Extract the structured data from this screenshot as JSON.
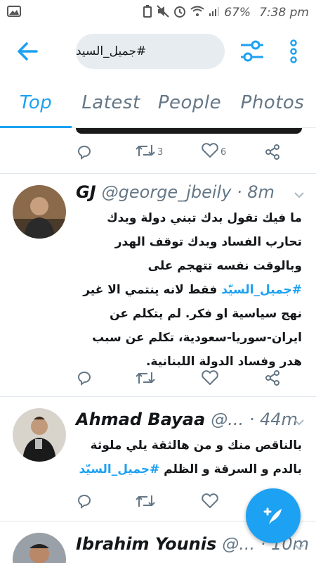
{
  "status_bar": {
    "battery": "67%",
    "time": "7:38 pm"
  },
  "search": {
    "query": "#جميل_السيد"
  },
  "tabs": [
    {
      "label": "Top"
    },
    {
      "label": "Latest"
    },
    {
      "label": "People"
    },
    {
      "label": "Photos"
    }
  ],
  "tweets": [
    {
      "retweets": "3",
      "likes": "6"
    },
    {
      "name": "GJ",
      "handle": "@george_jbeily · 8m",
      "text_before": "ما فيك تقول بدك تبني دولة وبدك تحارب الفساد وبدك توقف الهدر وبالوقت نفسه تتهجم على ",
      "hashtag": "#جميل_السيّد",
      "text_after": " فقط لانه ينتمي الا غير نهج سياسية او فكر. لم يتكلم عن ايران-سوريا-سعودية، تكلم عن سبب هدر وفساد الدولة اللبنانية."
    },
    {
      "name": "Ahmad Bayaa",
      "handle": "@... · 44m",
      "text_before": "بالناقص منك و من هالثقة يلي ملوثة بالدم و السرقة و الظلم ",
      "hashtag": "#جميل_السيّد"
    },
    {
      "name": "Ibrahim Younis",
      "handle": "@... · 10m"
    }
  ],
  "colors": {
    "accent": "#1da1f2",
    "muted": "#657786"
  },
  "icons": {
    "back": "arrow-left-icon",
    "filter": "sliders-icon",
    "more": "vertical-dots-icon",
    "reply": "reply-icon",
    "retweet": "retweet-icon",
    "like": "heart-icon",
    "share": "share-icon",
    "compose": "compose-tweet-icon"
  }
}
